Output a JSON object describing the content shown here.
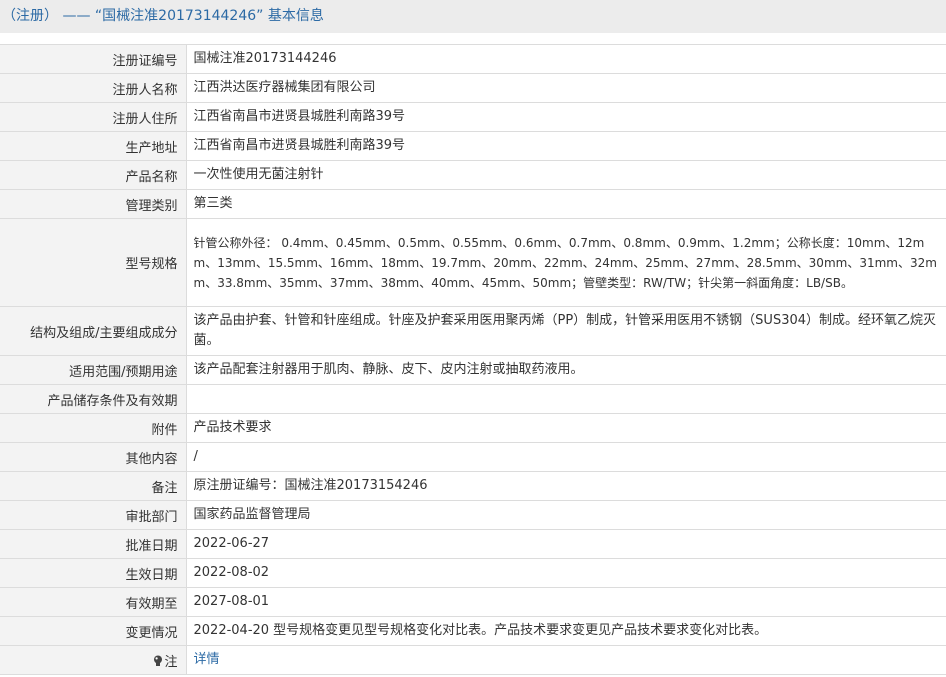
{
  "header": {
    "open_paren": "（注册）",
    "dash": "——",
    "title": "“国械注准20173144246”",
    "suffix": "基本信息"
  },
  "rows": [
    {
      "label": "注册证编号",
      "value": "国械注准20173144246"
    },
    {
      "label": "注册人名称",
      "value": "江西洪达医疗器械集团有限公司"
    },
    {
      "label": "注册人住所",
      "value": "江西省南昌市进贤县城胜利南路39号"
    },
    {
      "label": "生产地址",
      "value": "江西省南昌市进贤县城胜利南路39号"
    },
    {
      "label": "产品名称",
      "value": "一次性使用无菌注射针"
    },
    {
      "label": "管理类别",
      "value": "第三类"
    },
    {
      "label": "型号规格",
      "value": "针管公称外径： 0.4mm、0.45mm、0.5mm、0.55mm、0.6mm、0.7mm、0.8mm、0.9mm、1.2mm；公称长度：10mm、12mm、13mm、15.5mm、16mm、18mm、19.7mm、20mm、22mm、24mm、25mm、27mm、28.5mm、30mm、31mm、32mm、33.8mm、35mm、37mm、38mm、40mm、45mm、50mm；管壁类型：RW/TW；针尖第一斜面角度：LB/SB。"
    },
    {
      "label": "结构及组成/主要组成成分",
      "value": "该产品由护套、针管和针座组成。针座及护套采用医用聚丙烯（PP）制成，针管采用医用不锈钢（SUS304）制成。经环氧乙烷灭菌。"
    },
    {
      "label": "适用范围/预期用途",
      "value": "该产品配套注射器用于肌肉、静脉、皮下、皮内注射或抽取药液用。"
    },
    {
      "label": "产品储存条件及有效期",
      "value": ""
    },
    {
      "label": "附件",
      "value": "产品技术要求"
    },
    {
      "label": "其他内容",
      "value": "/"
    },
    {
      "label": "备注",
      "value": "原注册证编号：国械注准20173154246"
    },
    {
      "label": "审批部门",
      "value": "国家药品监督管理局"
    },
    {
      "label": "批准日期",
      "value": "2022-06-27"
    },
    {
      "label": "生效日期",
      "value": "2022-08-02"
    },
    {
      "label": "有效期至",
      "value": "2027-08-01"
    },
    {
      "label": "变更情况",
      "value": "2022-04-20 型号规格变更见型号规格变化对比表。产品技术要求变更见产品技术要求变化对比表。"
    }
  ],
  "note_row": {
    "label": "注",
    "link_text": "详情",
    "icon": "lightbulb-icon"
  }
}
